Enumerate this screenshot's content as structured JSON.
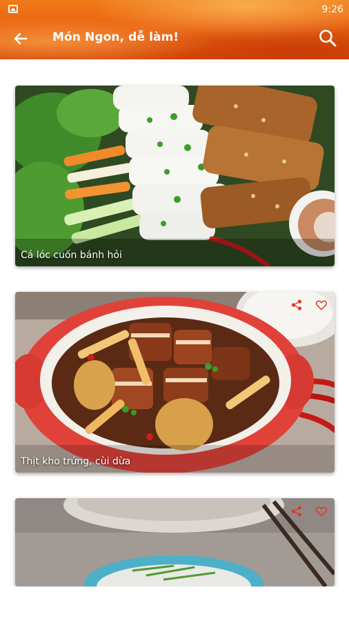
{
  "statusbar": {
    "time": "9:26"
  },
  "appbar": {
    "title": "Món Ngon, dễ làm!"
  },
  "colors": {
    "accent": "#e85d10",
    "action_icon": "#e2372b"
  },
  "recipes": [
    {
      "caption": "Cá lóc cuốn bánh hỏi",
      "has_actions": false
    },
    {
      "caption": "Thịt kho trứng, cùi dừa",
      "has_actions": true
    },
    {
      "caption": "",
      "has_actions": true
    }
  ]
}
